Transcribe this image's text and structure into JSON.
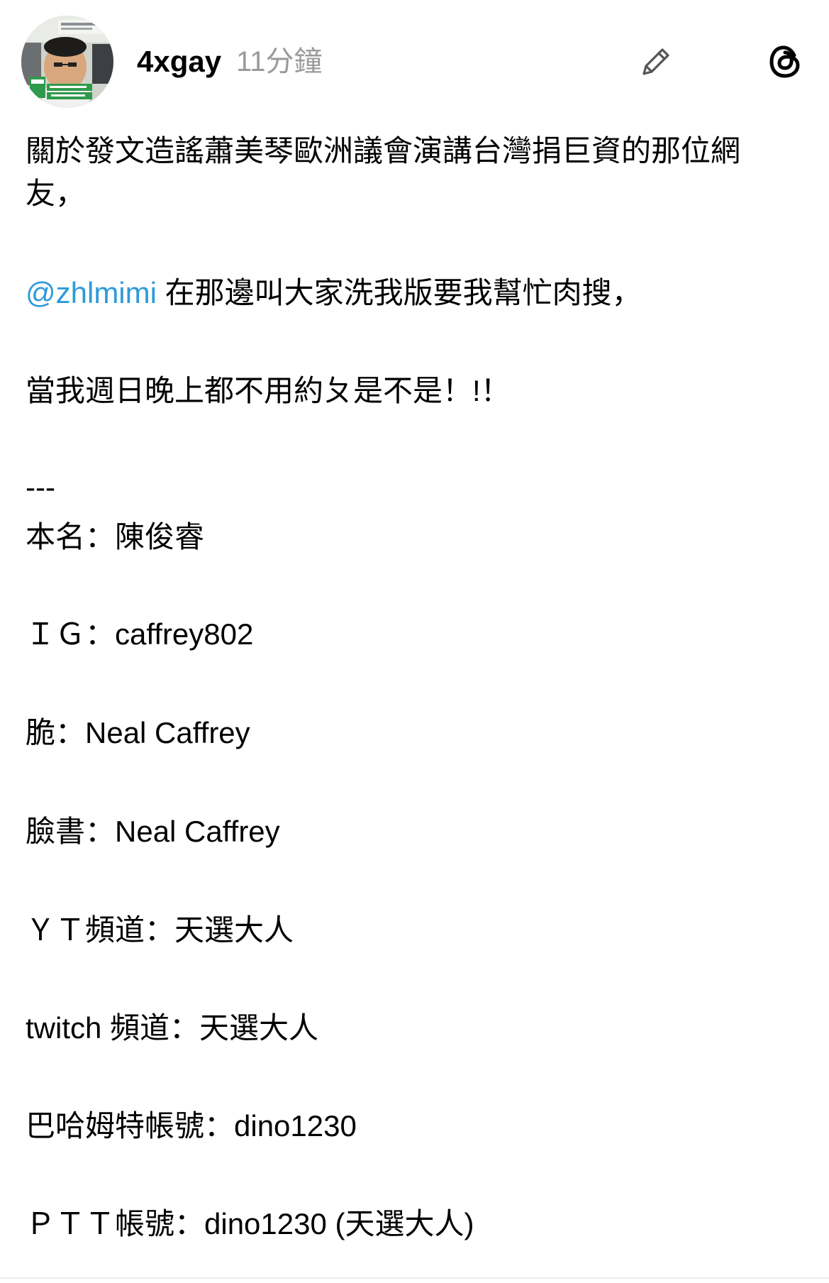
{
  "post": {
    "author": {
      "username": "4xgay",
      "timestamp": "11分鐘"
    },
    "actions": {
      "edit_icon": "pencil-icon",
      "app_icon": "threads-icon"
    },
    "content": {
      "line1": "關於發文造謠蕭美琴歐洲議會演講台灣捐巨資的那位網",
      "line2": "友，",
      "mention": "@zhlmimi",
      "line3_rest": " 在那邊叫大家洗我版要我幫忙肉搜，",
      "line4": "當我週日晚上都不用約ㄆ是不是！!！",
      "separator": "---",
      "real_name": "本名：陳俊睿",
      "ig": "ＩＧ：caffrey802",
      "dcard": "脆：Neal Caffrey",
      "facebook": "臉書：Neal Caffrey",
      "youtube": "ＹＴ頻道：天選大人",
      "twitch": "twitch 頻道：天選大人",
      "bahamut": "巴哈姆特帳號：dino1230",
      "ptt": "ＰＴＴ帳號：dino1230 (天選大人)"
    },
    "colors": {
      "mention": "#2e9ad9",
      "timestamp": "#9a9a9a",
      "text": "#000000"
    }
  }
}
